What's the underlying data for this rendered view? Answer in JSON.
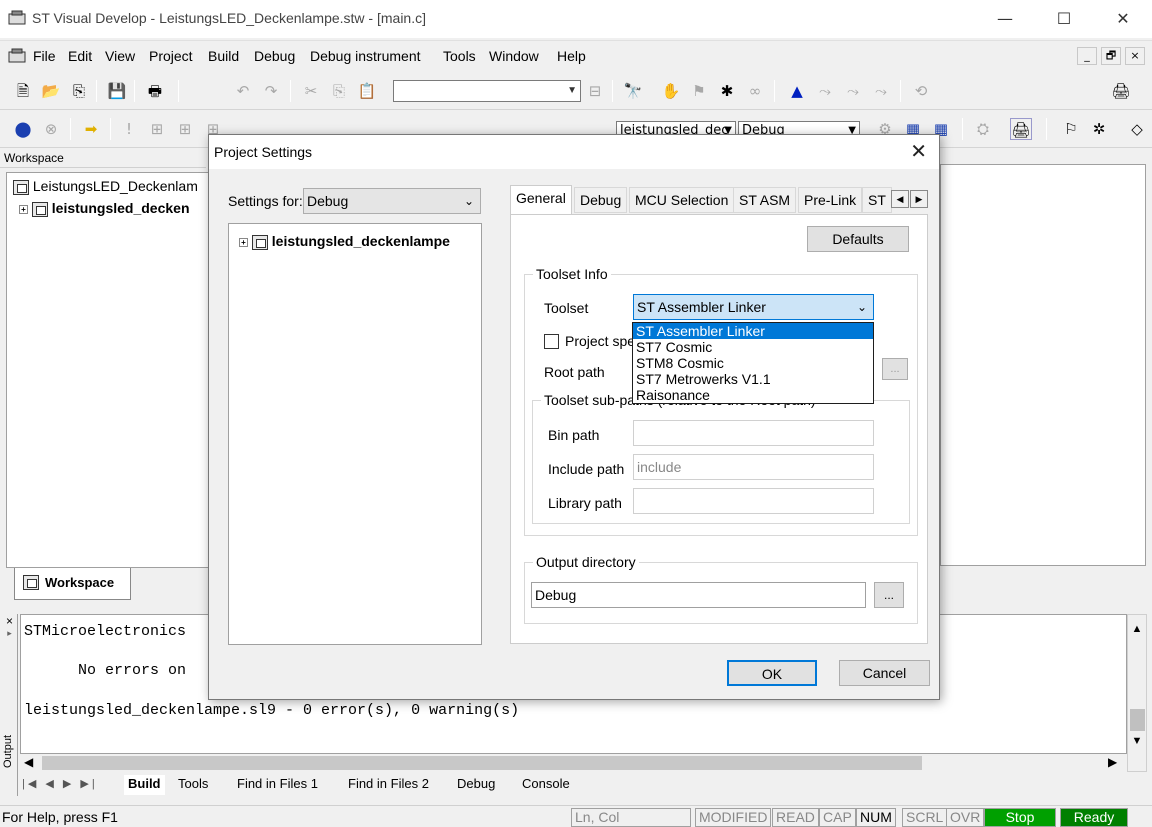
{
  "window": {
    "title": "ST Visual Develop - LeistungsLED_Deckenlampe.stw - [main.c]",
    "controls": [
      "—",
      "☐",
      "✕"
    ]
  },
  "menu": {
    "items": [
      "File",
      "Edit",
      "View",
      "Project",
      "Build",
      "Debug",
      "Debug instrument",
      "Tools",
      "Window",
      "Help"
    ],
    "mdi": [
      "_",
      "🗗",
      "×"
    ]
  },
  "toolbar": {
    "search_value": "",
    "config_combo": "leistungsled_dec",
    "build_combo": "Debug"
  },
  "workspace": {
    "label": "Workspace",
    "root": "LeistungsLED_Deckenlam",
    "project": "leistungsled_decken",
    "tab": "Workspace"
  },
  "output": {
    "side_label": "Output",
    "lines": [
      "STMicroelectronics",
      "      No errors on",
      "leistungsled_deckenlampe.sl9 - 0 error(s), 0 warning(s)"
    ],
    "tabs": [
      "Build",
      "Tools",
      "Find in Files 1",
      "Find in Files 2",
      "Debug",
      "Console"
    ]
  },
  "statusbar": {
    "help": "For Help, press F1",
    "lncol": "Ln, Col",
    "modified": "MODIFIED",
    "read": "READ",
    "cap": "CAP",
    "num": "NUM",
    "scrl": "SCRL",
    "ovr": "OVR",
    "stop": "Stop",
    "ready": "Ready"
  },
  "dialog": {
    "title": "Project Settings",
    "settings_for_label": "Settings for:",
    "settings_for_value": "Debug",
    "tree_project": "leistungsled_deckenlampe",
    "tabs": [
      "General",
      "Debug",
      "MCU Selection",
      "ST ASM",
      "Pre-Link",
      "ST"
    ],
    "defaults_button": "Defaults",
    "toolset_info_group": "Toolset Info",
    "toolset_label": "Toolset",
    "toolset_value": "ST Assembler Linker",
    "toolset_options": [
      "ST Assembler Linker",
      "ST7 Cosmic",
      "STM8 Cosmic",
      "ST7 Metrowerks V1.1",
      "Raisonance"
    ],
    "project_specific_label": "Project spec",
    "root_path_label": "Root path",
    "sub_paths_group": "Toolset sub-paths (relative to the Root path)",
    "bin_path_label": "Bin path",
    "bin_path_value": "",
    "include_path_label": "Include path",
    "include_path_value": "include",
    "library_path_label": "Library path",
    "library_path_value": "",
    "output_dir_group": "Output directory",
    "output_dir_value": "Debug",
    "browse": "...",
    "ok_button": "OK",
    "cancel_button": "Cancel"
  },
  "colors": {
    "accent": "#0078d7",
    "stop_bg": "#00a000",
    "ready_bg": "#008000"
  }
}
